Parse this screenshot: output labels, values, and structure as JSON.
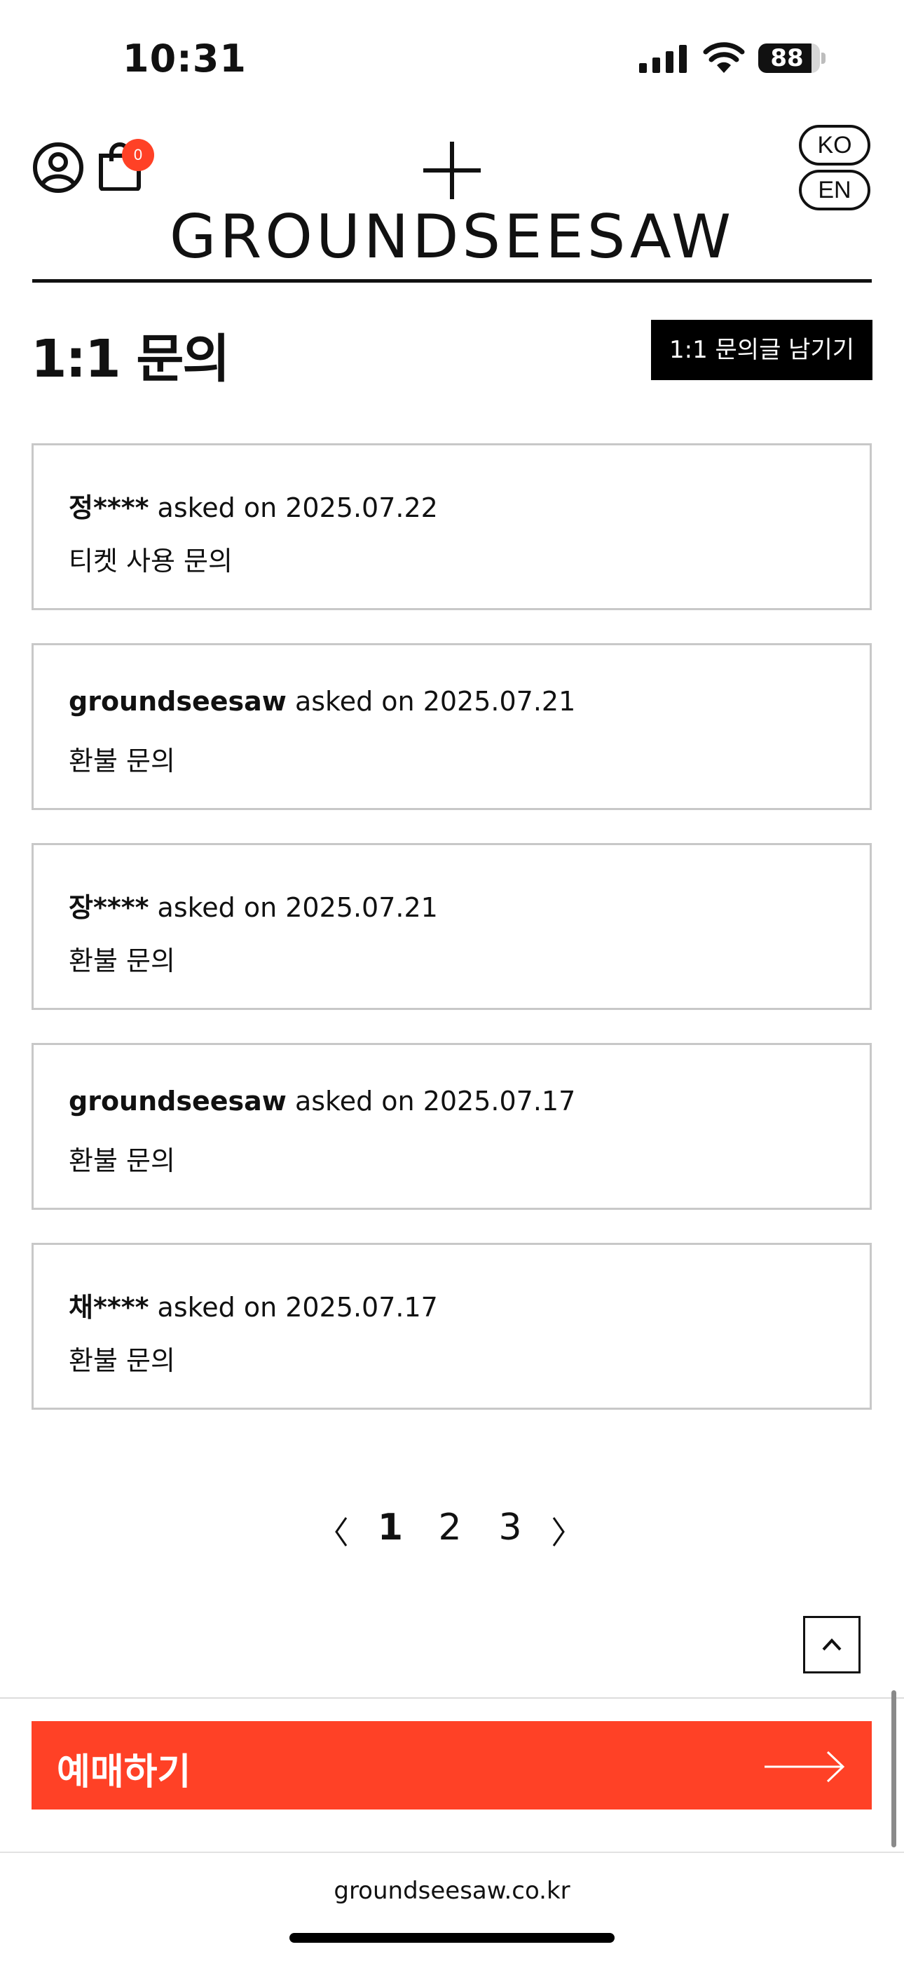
{
  "status_bar": {
    "time": "10:31",
    "battery": "88",
    "icons": [
      "signal-icon",
      "wifi-icon",
      "battery-icon"
    ]
  },
  "header": {
    "brand": "GROUNDSEESAW",
    "cart_count": "0",
    "lang_ko": "KO",
    "lang_en": "EN",
    "icons": [
      "account-icon",
      "cart-icon",
      "plus-logo-icon"
    ]
  },
  "page": {
    "title": "1:1 문의",
    "write_button": "1:1 문의글 남기기"
  },
  "inquiries": [
    {
      "author": "정****",
      "asked": " asked on 2025.07.22",
      "subject": "티켓 사용 문의"
    },
    {
      "author": "groundseesaw",
      "asked": " asked on 2025.07.21",
      "subject": "환불 문의"
    },
    {
      "author": "장****",
      "asked": " asked on 2025.07.21",
      "subject": "환불 문의"
    },
    {
      "author": "groundseesaw",
      "asked": " asked on 2025.07.17",
      "subject": "환불 문의"
    },
    {
      "author": "채****",
      "asked": " asked on 2025.07.17",
      "subject": "환불 문의"
    }
  ],
  "pagination": {
    "pages": [
      "1",
      "2",
      "3"
    ],
    "current": "1"
  },
  "footer": {
    "book_label": "예매하기",
    "url": "groundseesaw.co.kr"
  },
  "colors": {
    "accent": "#ff4126",
    "black": "#111111",
    "card_border": "#c8c8c8"
  }
}
